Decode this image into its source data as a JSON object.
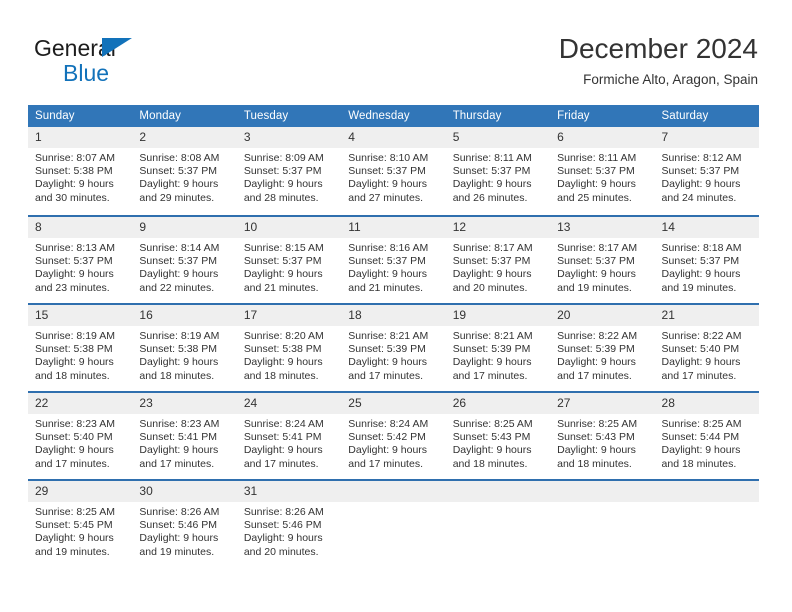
{
  "brand": {
    "name_top": "General",
    "name_bottom": "Blue",
    "logo_icon": "triangle-logo-icon",
    "accent_color": "#1272ba"
  },
  "header": {
    "title": "December 2024",
    "subtitle": "Formiche Alto, Aragon, Spain"
  },
  "calendar": {
    "header_color": "#3176b8",
    "weekday_headers": [
      "Sunday",
      "Monday",
      "Tuesday",
      "Wednesday",
      "Thursday",
      "Friday",
      "Saturday"
    ],
    "weeks": [
      [
        {
          "day": "1",
          "sunrise": "Sunrise: 8:07 AM",
          "sunset": "Sunset: 5:38 PM",
          "daylight_line1": "Daylight: 9 hours",
          "daylight_line2": "and 30 minutes."
        },
        {
          "day": "2",
          "sunrise": "Sunrise: 8:08 AM",
          "sunset": "Sunset: 5:37 PM",
          "daylight_line1": "Daylight: 9 hours",
          "daylight_line2": "and 29 minutes."
        },
        {
          "day": "3",
          "sunrise": "Sunrise: 8:09 AM",
          "sunset": "Sunset: 5:37 PM",
          "daylight_line1": "Daylight: 9 hours",
          "daylight_line2": "and 28 minutes."
        },
        {
          "day": "4",
          "sunrise": "Sunrise: 8:10 AM",
          "sunset": "Sunset: 5:37 PM",
          "daylight_line1": "Daylight: 9 hours",
          "daylight_line2": "and 27 minutes."
        },
        {
          "day": "5",
          "sunrise": "Sunrise: 8:11 AM",
          "sunset": "Sunset: 5:37 PM",
          "daylight_line1": "Daylight: 9 hours",
          "daylight_line2": "and 26 minutes."
        },
        {
          "day": "6",
          "sunrise": "Sunrise: 8:11 AM",
          "sunset": "Sunset: 5:37 PM",
          "daylight_line1": "Daylight: 9 hours",
          "daylight_line2": "and 25 minutes."
        },
        {
          "day": "7",
          "sunrise": "Sunrise: 8:12 AM",
          "sunset": "Sunset: 5:37 PM",
          "daylight_line1": "Daylight: 9 hours",
          "daylight_line2": "and 24 minutes."
        }
      ],
      [
        {
          "day": "8",
          "sunrise": "Sunrise: 8:13 AM",
          "sunset": "Sunset: 5:37 PM",
          "daylight_line1": "Daylight: 9 hours",
          "daylight_line2": "and 23 minutes."
        },
        {
          "day": "9",
          "sunrise": "Sunrise: 8:14 AM",
          "sunset": "Sunset: 5:37 PM",
          "daylight_line1": "Daylight: 9 hours",
          "daylight_line2": "and 22 minutes."
        },
        {
          "day": "10",
          "sunrise": "Sunrise: 8:15 AM",
          "sunset": "Sunset: 5:37 PM",
          "daylight_line1": "Daylight: 9 hours",
          "daylight_line2": "and 21 minutes."
        },
        {
          "day": "11",
          "sunrise": "Sunrise: 8:16 AM",
          "sunset": "Sunset: 5:37 PM",
          "daylight_line1": "Daylight: 9 hours",
          "daylight_line2": "and 21 minutes."
        },
        {
          "day": "12",
          "sunrise": "Sunrise: 8:17 AM",
          "sunset": "Sunset: 5:37 PM",
          "daylight_line1": "Daylight: 9 hours",
          "daylight_line2": "and 20 minutes."
        },
        {
          "day": "13",
          "sunrise": "Sunrise: 8:17 AM",
          "sunset": "Sunset: 5:37 PM",
          "daylight_line1": "Daylight: 9 hours",
          "daylight_line2": "and 19 minutes."
        },
        {
          "day": "14",
          "sunrise": "Sunrise: 8:18 AM",
          "sunset": "Sunset: 5:37 PM",
          "daylight_line1": "Daylight: 9 hours",
          "daylight_line2": "and 19 minutes."
        }
      ],
      [
        {
          "day": "15",
          "sunrise": "Sunrise: 8:19 AM",
          "sunset": "Sunset: 5:38 PM",
          "daylight_line1": "Daylight: 9 hours",
          "daylight_line2": "and 18 minutes."
        },
        {
          "day": "16",
          "sunrise": "Sunrise: 8:19 AM",
          "sunset": "Sunset: 5:38 PM",
          "daylight_line1": "Daylight: 9 hours",
          "daylight_line2": "and 18 minutes."
        },
        {
          "day": "17",
          "sunrise": "Sunrise: 8:20 AM",
          "sunset": "Sunset: 5:38 PM",
          "daylight_line1": "Daylight: 9 hours",
          "daylight_line2": "and 18 minutes."
        },
        {
          "day": "18",
          "sunrise": "Sunrise: 8:21 AM",
          "sunset": "Sunset: 5:39 PM",
          "daylight_line1": "Daylight: 9 hours",
          "daylight_line2": "and 17 minutes."
        },
        {
          "day": "19",
          "sunrise": "Sunrise: 8:21 AM",
          "sunset": "Sunset: 5:39 PM",
          "daylight_line1": "Daylight: 9 hours",
          "daylight_line2": "and 17 minutes."
        },
        {
          "day": "20",
          "sunrise": "Sunrise: 8:22 AM",
          "sunset": "Sunset: 5:39 PM",
          "daylight_line1": "Daylight: 9 hours",
          "daylight_line2": "and 17 minutes."
        },
        {
          "day": "21",
          "sunrise": "Sunrise: 8:22 AM",
          "sunset": "Sunset: 5:40 PM",
          "daylight_line1": "Daylight: 9 hours",
          "daylight_line2": "and 17 minutes."
        }
      ],
      [
        {
          "day": "22",
          "sunrise": "Sunrise: 8:23 AM",
          "sunset": "Sunset: 5:40 PM",
          "daylight_line1": "Daylight: 9 hours",
          "daylight_line2": "and 17 minutes."
        },
        {
          "day": "23",
          "sunrise": "Sunrise: 8:23 AM",
          "sunset": "Sunset: 5:41 PM",
          "daylight_line1": "Daylight: 9 hours",
          "daylight_line2": "and 17 minutes."
        },
        {
          "day": "24",
          "sunrise": "Sunrise: 8:24 AM",
          "sunset": "Sunset: 5:41 PM",
          "daylight_line1": "Daylight: 9 hours",
          "daylight_line2": "and 17 minutes."
        },
        {
          "day": "25",
          "sunrise": "Sunrise: 8:24 AM",
          "sunset": "Sunset: 5:42 PM",
          "daylight_line1": "Daylight: 9 hours",
          "daylight_line2": "and 17 minutes."
        },
        {
          "day": "26",
          "sunrise": "Sunrise: 8:25 AM",
          "sunset": "Sunset: 5:43 PM",
          "daylight_line1": "Daylight: 9 hours",
          "daylight_line2": "and 18 minutes."
        },
        {
          "day": "27",
          "sunrise": "Sunrise: 8:25 AM",
          "sunset": "Sunset: 5:43 PM",
          "daylight_line1": "Daylight: 9 hours",
          "daylight_line2": "and 18 minutes."
        },
        {
          "day": "28",
          "sunrise": "Sunrise: 8:25 AM",
          "sunset": "Sunset: 5:44 PM",
          "daylight_line1": "Daylight: 9 hours",
          "daylight_line2": "and 18 minutes."
        }
      ],
      [
        {
          "day": "29",
          "sunrise": "Sunrise: 8:25 AM",
          "sunset": "Sunset: 5:45 PM",
          "daylight_line1": "Daylight: 9 hours",
          "daylight_line2": "and 19 minutes."
        },
        {
          "day": "30",
          "sunrise": "Sunrise: 8:26 AM",
          "sunset": "Sunset: 5:46 PM",
          "daylight_line1": "Daylight: 9 hours",
          "daylight_line2": "and 19 minutes."
        },
        {
          "day": "31",
          "sunrise": "Sunrise: 8:26 AM",
          "sunset": "Sunset: 5:46 PM",
          "daylight_line1": "Daylight: 9 hours",
          "daylight_line2": "and 20 minutes."
        },
        {
          "day": "",
          "sunrise": "",
          "sunset": "",
          "daylight_line1": "",
          "daylight_line2": ""
        },
        {
          "day": "",
          "sunrise": "",
          "sunset": "",
          "daylight_line1": "",
          "daylight_line2": ""
        },
        {
          "day": "",
          "sunrise": "",
          "sunset": "",
          "daylight_line1": "",
          "daylight_line2": ""
        },
        {
          "day": "",
          "sunrise": "",
          "sunset": "",
          "daylight_line1": "",
          "daylight_line2": ""
        }
      ]
    ]
  }
}
